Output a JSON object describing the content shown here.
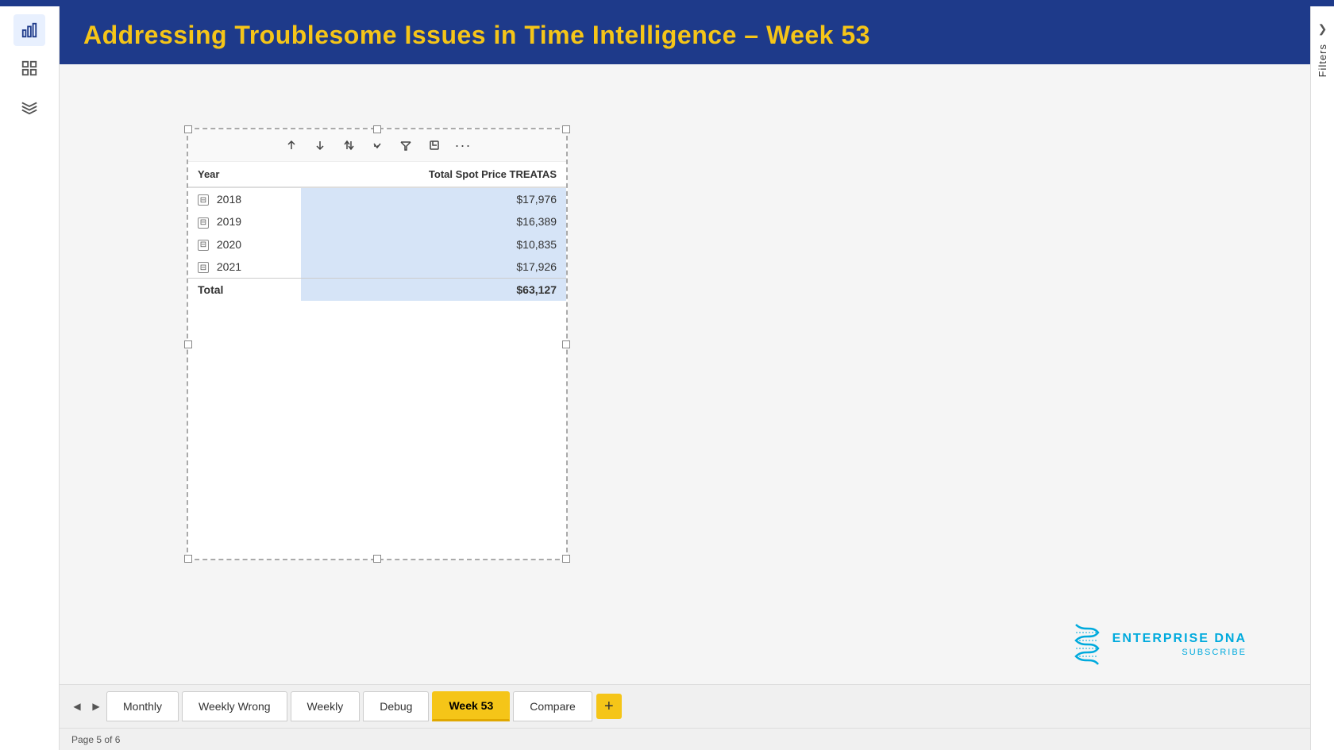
{
  "app": {
    "title": "Addressing Troublesome Issues in Time Intelligence – Week 53",
    "status": "Page 5 of 6"
  },
  "sidebar": {
    "icons": [
      {
        "name": "bar-chart-icon",
        "symbol": "📊",
        "active": true
      },
      {
        "name": "grid-icon",
        "symbol": "⊞",
        "active": false
      },
      {
        "name": "layers-icon",
        "symbol": "⊟",
        "active": false
      }
    ]
  },
  "toolbar": {
    "sort_asc": "↑",
    "sort_desc": "↓",
    "sort_both": "⇅",
    "drill": "↓",
    "filter": "⊻",
    "expand": "⊡",
    "more": "···"
  },
  "table": {
    "columns": [
      {
        "key": "year",
        "label": "Year"
      },
      {
        "key": "total_spot_price",
        "label": "Total Spot Price TREATAS"
      }
    ],
    "rows": [
      {
        "year": "2018",
        "value": "$17,976",
        "expandable": true
      },
      {
        "year": "2019",
        "value": "$16,389",
        "expandable": true
      },
      {
        "year": "2020",
        "value": "$10,835",
        "expandable": true
      },
      {
        "year": "2021",
        "value": "$17,926",
        "expandable": true
      }
    ],
    "total": {
      "label": "Total",
      "value": "$63,127"
    }
  },
  "logo": {
    "company": "ENTERPRISE DNA",
    "subscribe": "SUBSCRIBE"
  },
  "right_panel": {
    "label": "Filters"
  },
  "tabs": [
    {
      "id": "monthly",
      "label": "Monthly",
      "active": false
    },
    {
      "id": "weekly-wrong",
      "label": "Weekly Wrong",
      "active": false
    },
    {
      "id": "weekly",
      "label": "Weekly",
      "active": false
    },
    {
      "id": "debug",
      "label": "Debug",
      "active": false
    },
    {
      "id": "week-53",
      "label": "Week 53",
      "active": true
    },
    {
      "id": "compare",
      "label": "Compare",
      "active": false
    }
  ],
  "tab_add_label": "+"
}
